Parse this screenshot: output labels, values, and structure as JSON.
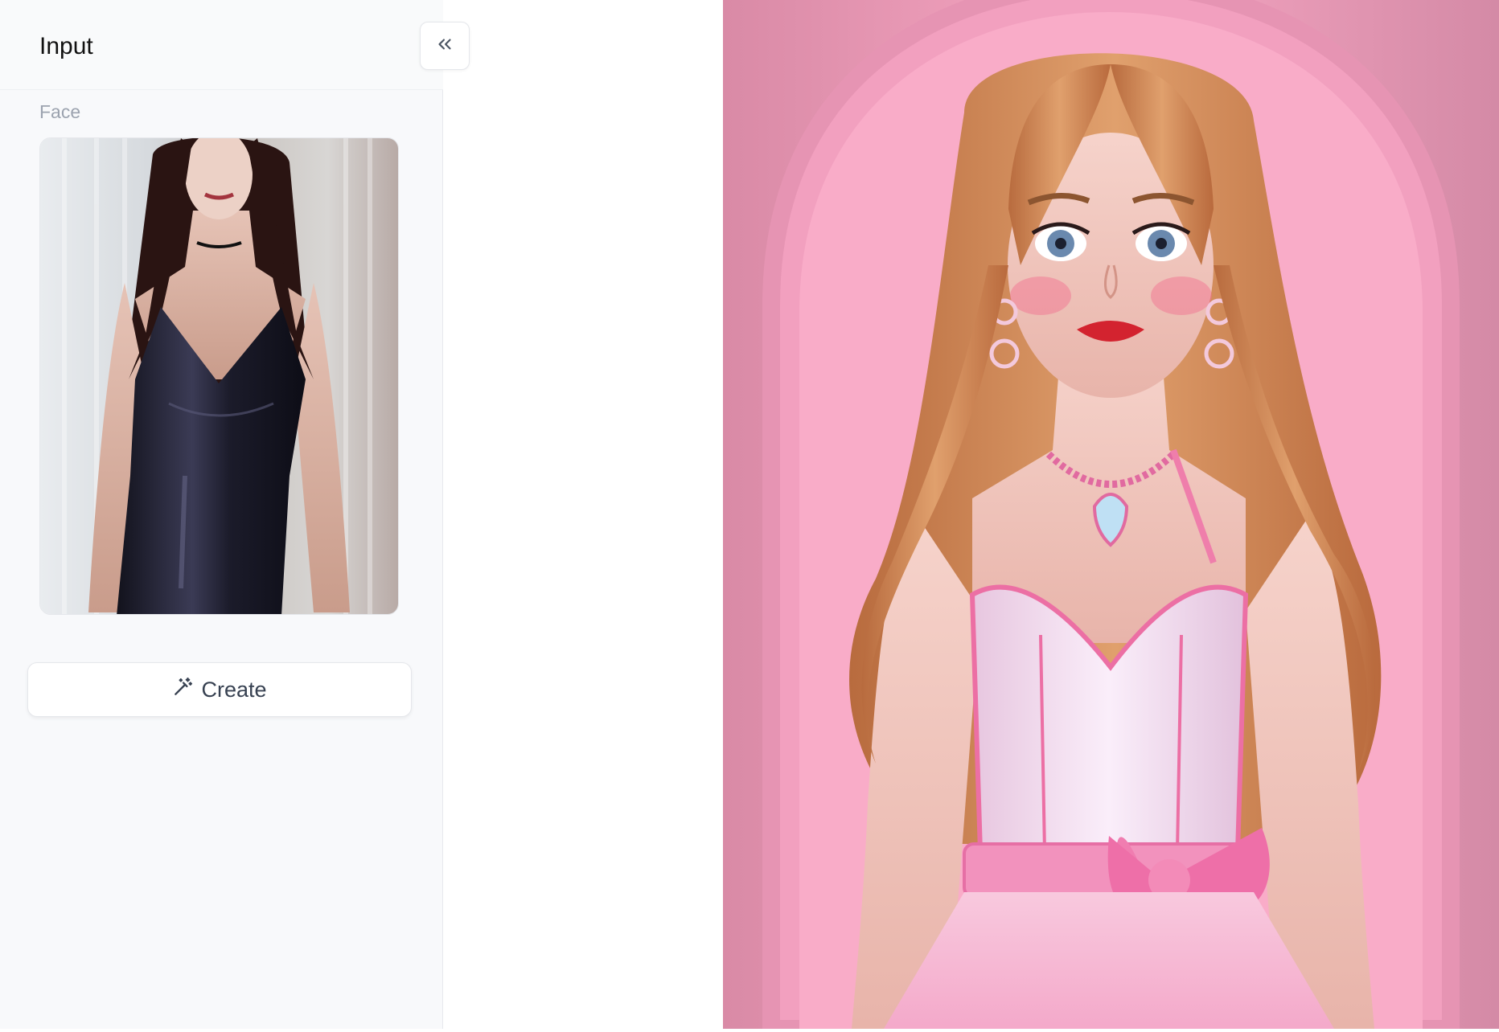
{
  "panel": {
    "title": "Input",
    "collapse_icon": "chevrons-left-icon"
  },
  "face": {
    "label": "Face",
    "image_alt": "uploaded face photo"
  },
  "create_button": {
    "label": "Create",
    "icon": "magic-wand-icon"
  },
  "result": {
    "image_alt": "generated doll-style portrait"
  },
  "colors": {
    "panel_bg": "#f8f9fb",
    "border": "#e5e7eb",
    "result_bg": "#f5a3c0"
  }
}
